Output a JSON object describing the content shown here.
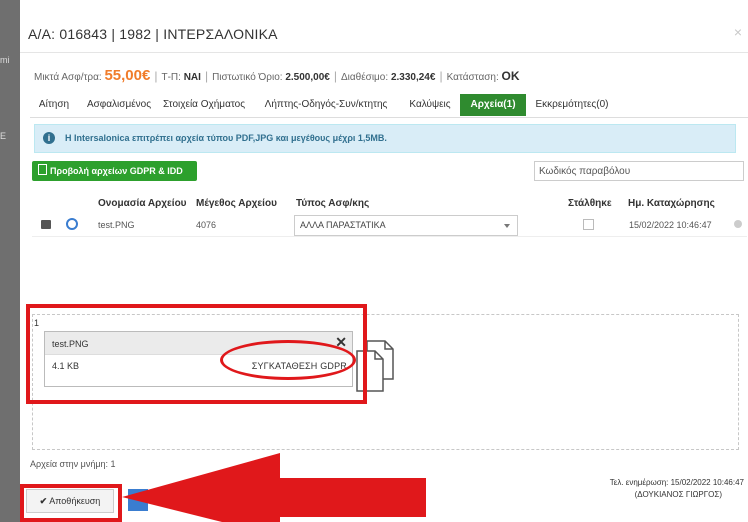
{
  "backdrop": {
    "frag1": "mi",
    "frag2": "E"
  },
  "window": {
    "title": "Α/Α: 016843 | 1982 | ΙΝΤΕΡΣΑΛΟΝΙΚΑ",
    "close_glyph": "×"
  },
  "info": {
    "premium_label": "Μικτά Ασφ/τρα:",
    "premium_value": "55,00€",
    "tp_label": "Τ-Π:",
    "tp_value": "ΝΑΙ",
    "credit_label": "Πιστωτικό Όριο:",
    "credit_value": "2.500,00€",
    "available_label": "Διαθέσιμο:",
    "available_value": "2.330,24€",
    "status_label": "Κατάσταση:",
    "status_value": "OK"
  },
  "tabs": [
    "Αίτηση",
    "Ασφαλισμένος",
    "Στοιχεία Οχήματος",
    "Λήπτης-Οδηγός-Συν/κτητης",
    "Καλύψεις",
    "Αρχεία(1)",
    "Εκκρεμότητες(0)"
  ],
  "alert": {
    "message": "Η Intersalonica επιτρέπει αρχεία τύπου PDF,JPG και μεγέθους μέχρι 1,5MB."
  },
  "gdpr_button": {
    "label": "Προβολή αρχείων GDPR & IDD"
  },
  "search": {
    "placeholder": "Κωδικός παραβόλου"
  },
  "table": {
    "columns": [
      "Ονομασία Αρχείου",
      "Μέγεθος Αρχείου",
      "Τύπος Ασφ/κης",
      "Στάλθηκε",
      "Ημ. Καταχώρησης"
    ],
    "rows": [
      {
        "name": "test.PNG",
        "size": "4076",
        "type": "ΑΛΛΑ ΠΑΡΑΣΤΑΤΙΚΑ",
        "sent": false,
        "date": "15/02/2022 10:46:47"
      }
    ]
  },
  "dropzone": {
    "count": "1",
    "file_name": "test.PNG",
    "file_size": "4.1 KB",
    "file_type": "ΣΥΓΚΑΤΑΘΕΣΗ GDPR",
    "remove_glyph": "✕"
  },
  "files_in_memory": "Αρχεία στην μνήμη: 1",
  "save_button": {
    "label": "Αποθήκευση",
    "glyph": "✔"
  },
  "last_update": {
    "line1": "Τελ. ενημέρωση: 15/02/2022 10:46:47",
    "line2": "(ΔΟΥΚΙΑΝΟΣ ΓΙΩΡΓΟΣ)"
  },
  "colors": {
    "accent_green": "#2f8b2f",
    "premium_orange": "#f07c2a",
    "annotation_red": "#e0181b",
    "alert_bg": "#d9edf7"
  }
}
